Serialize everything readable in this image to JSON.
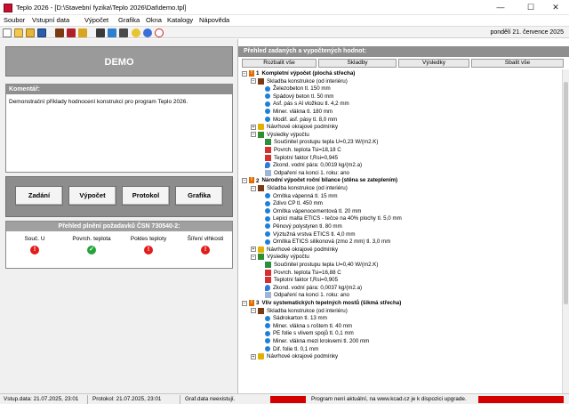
{
  "window": {
    "title": "Teplo 2026 - [D:\\Stavební fyzika\\Teplo 2026\\Dat\\demo.tpl]",
    "controls": {
      "minimize": "—",
      "maximize": "☐",
      "close": "✕"
    }
  },
  "menu": [
    "Soubor",
    "Vstupní data",
    "Výpočet",
    "Grafika",
    "Okna",
    "Katalogy",
    "Nápověda"
  ],
  "toolbar": {
    "date": "pondělí 21. července 2025",
    "icons": [
      "new-file-icon",
      "open-file-icon",
      "open-folder-icon",
      "save-icon",
      "layer-icon",
      "book-icon",
      "tools-icon",
      "calc-icon",
      "chart-icon",
      "help-icon",
      "info-icon",
      "chat-icon"
    ]
  },
  "left": {
    "demo_label": "DEMO",
    "comment_header": "Komentář:",
    "comment_text": "Demonstrační příklady hodnocení konstrukcí pro program Teplo 2026.",
    "buttons": {
      "zadani": "Zadání",
      "vypocet": "Výpočet",
      "protokol": "Protokol",
      "grafika": "Grafika"
    },
    "check_header": "Přehled plnění požadavků ČSN 730540-2:",
    "checks": [
      {
        "label": "Souč. U",
        "status": "fail"
      },
      {
        "label": "Povrch. teplota",
        "status": "pass"
      },
      {
        "label": "Pokles teploty",
        "status": "fail"
      },
      {
        "label": "Šíření vlhkosti",
        "status": "fail"
      }
    ]
  },
  "right": {
    "header": "Přehled zadaných a vypočtených hodnot:",
    "tabs": {
      "expand": "Rozbalit vše",
      "layers": "Skladby",
      "results": "Výsledky",
      "collapse": "Sbalit vše"
    },
    "tree": [
      {
        "kind": "section",
        "num": "1",
        "title": "Kompletní výpočet (plochá střecha)"
      },
      {
        "kind": "group",
        "icon": "stack",
        "text": "Skladba konstrukce (od interiéru)"
      },
      {
        "kind": "layer",
        "text": "Železobeton tl. 150 mm"
      },
      {
        "kind": "layer",
        "text": "Spádový beton tl. 50 mm"
      },
      {
        "kind": "layer",
        "text": "Asf. pás s Al vložkou tl. 4,2 mm"
      },
      {
        "kind": "layer",
        "text": "Miner. vlákna tl. 180 mm"
      },
      {
        "kind": "layer",
        "text": "Modif. asf. pásy tl. 8,0 mm"
      },
      {
        "kind": "group",
        "icon": "key",
        "text": "Návrhové okrajové podmínky"
      },
      {
        "kind": "group",
        "icon": "res",
        "text": "Výsledky výpočtu"
      },
      {
        "kind": "res",
        "icon": "flag",
        "text": "Součinitel prostupu tepla U=0,23 W/(m2.K)"
      },
      {
        "kind": "res",
        "icon": "warnsq",
        "text": "Povrch. teplota Tsi=18,18 C"
      },
      {
        "kind": "res",
        "icon": "warnsq",
        "text": "Teplotní faktor f,Rsi=0,945"
      },
      {
        "kind": "res",
        "icon": "drop",
        "text": "Zkond. vodní pára: 0,0019 kg/(m2.a)"
      },
      {
        "kind": "res",
        "icon": "steam",
        "text": "Odpaření na konci 1. roku: ano"
      },
      {
        "kind": "section",
        "num": "2",
        "title": "Národní výpočet roční bilance (stěna se zateplením)"
      },
      {
        "kind": "group",
        "icon": "stack",
        "text": "Skladba konstrukce (od interiéru)"
      },
      {
        "kind": "layer",
        "text": "Omítka vápenná tl. 15 mm"
      },
      {
        "kind": "layer",
        "text": "Zdivo CP tl. 450 mm"
      },
      {
        "kind": "layer",
        "text": "Omítka vápenocementová tl. 20 mm"
      },
      {
        "kind": "layer",
        "text": "Lepicí malta ETICS - tečce na 40% plochy tl. 5,0 mm"
      },
      {
        "kind": "layer",
        "text": "Pěnový polystyren tl. 80 mm"
      },
      {
        "kind": "layer",
        "text": "Výztužná vrstva ETICS tl. 4,0 mm"
      },
      {
        "kind": "layer",
        "text": "Omítka ETICS silikonová (zmo 2 mm) tl. 3,0 mm"
      },
      {
        "kind": "group",
        "icon": "key",
        "text": "Návrhové okrajové podmínky"
      },
      {
        "kind": "group",
        "icon": "res",
        "text": "Výsledky výpočtu"
      },
      {
        "kind": "res",
        "icon": "flag",
        "text": "Součinitel prostupu tepla U=0,40 W/(m2.K)"
      },
      {
        "kind": "res",
        "icon": "warnsq",
        "text": "Povrch. teplota Tsi=16,88 C"
      },
      {
        "kind": "res",
        "icon": "warnsq",
        "text": "Teplotní faktor f,Rsi=0,905"
      },
      {
        "kind": "res",
        "icon": "drop",
        "text": "Zkond. vodní pára: 0,0037 kg/(m2.a)"
      },
      {
        "kind": "res",
        "icon": "steam",
        "text": "Odpaření na konci 1. roku: ano"
      },
      {
        "kind": "section",
        "num": "3",
        "title": "Vliv systematických tepelných mostů (šikmá střecha)"
      },
      {
        "kind": "group",
        "icon": "stack",
        "text": "Skladba konstrukce (od interiéru)"
      },
      {
        "kind": "layer",
        "text": "Sádrokarton tl. 13 mm"
      },
      {
        "kind": "layer",
        "text": "Miner. vlákna s roštem tl. 40 mm"
      },
      {
        "kind": "layer",
        "text": "PE folie s vlivem spojů tl. 0,1 mm"
      },
      {
        "kind": "layer",
        "text": "Miner. vlákna mezi krokvemi tl. 200 mm"
      },
      {
        "kind": "layer",
        "text": "Dif. folie tl. 0,1 mm"
      },
      {
        "kind": "group",
        "icon": "key",
        "text": "Návrhové okrajové podmínky"
      }
    ]
  },
  "status": {
    "input_data": "Vstup.data: 21.07.2025, 23:01",
    "protocol": "Protokol: 21.07.2025, 23:01",
    "graphics": "Graf.data neexistují.",
    "update_msg": "Program není aktuální, na www.kcad.cz je k dispozici upgrade."
  }
}
